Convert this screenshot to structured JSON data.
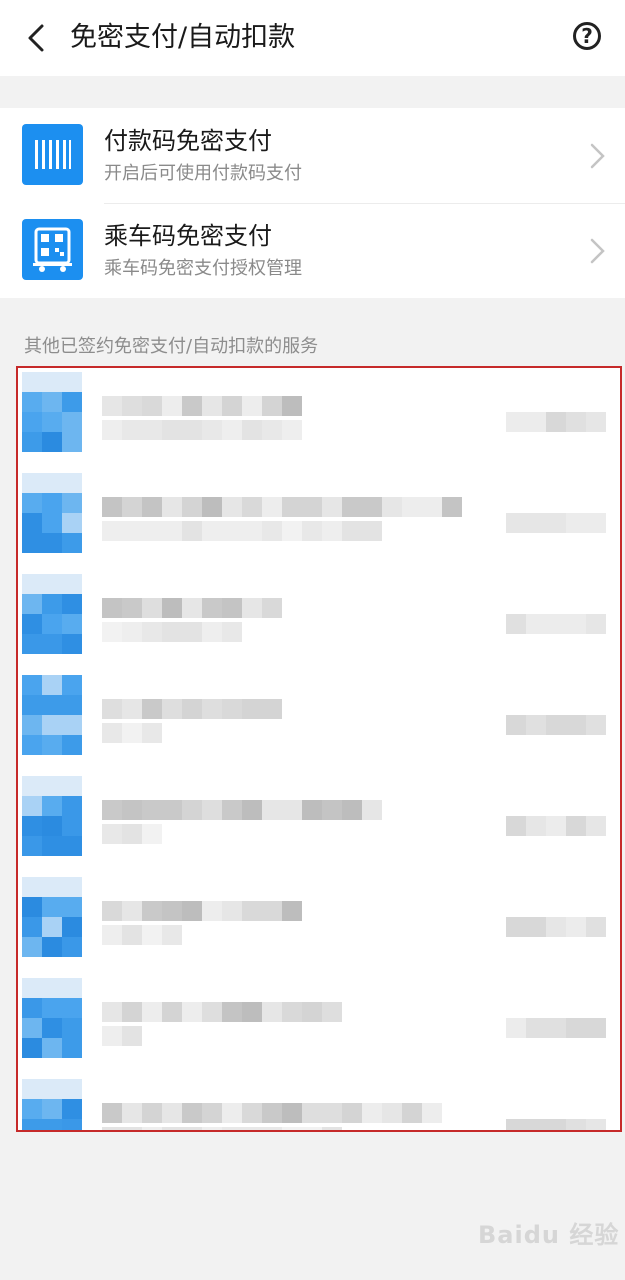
{
  "header": {
    "title": "免密支付/自动扣款",
    "back_icon": "back-arrow-icon",
    "help_icon": "question-circle-icon",
    "help_glyph": "?"
  },
  "settings": [
    {
      "title": "付款码免密支付",
      "subtitle": "开启后可使用付款码支付",
      "icon": "barcode-icon"
    },
    {
      "title": "乘车码免密支付",
      "subtitle": "乘车码免密支付授权管理",
      "icon": "bus-qr-icon"
    }
  ],
  "section": {
    "label": "其他已签约免密支付/自动扣款的服务"
  },
  "services_count": 8,
  "watermark": "Baidu 经验",
  "colors": {
    "accent": "#1c8ff0",
    "highlight_border": "#c62a2a"
  }
}
